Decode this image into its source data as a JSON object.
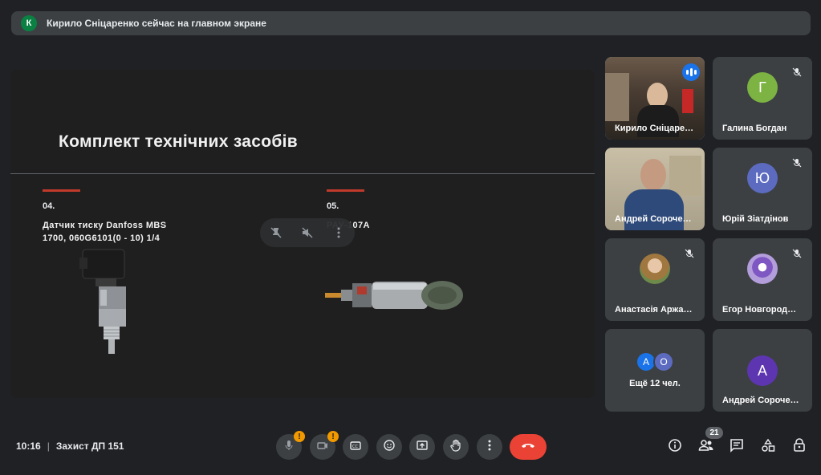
{
  "banner": {
    "avatar_letter": "К",
    "text": "Кирило Сніцаренко сейчас на главном экране"
  },
  "slide": {
    "title": "Комплект технічних засобів",
    "items": [
      {
        "number": "04.",
        "title_line1": "Датчик тиску Danfoss MBS",
        "title_line2": "1700, 060G6101(0 - 10) 1/4"
      },
      {
        "number": "05.",
        "title_line1": "РАУ-107А",
        "title_line2": ""
      }
    ]
  },
  "participants": [
    {
      "name": "Кирило Сніцаре…",
      "type": "video",
      "speaking": true
    },
    {
      "name": "Галина Богдан",
      "letter": "Г",
      "color": "#7cb342",
      "muted": true
    },
    {
      "name": "Андрей Сороче…",
      "type": "video",
      "speaking": false
    },
    {
      "name": "Юрій Зіатдінов",
      "letter": "Ю",
      "color": "#5c6bc0",
      "muted": true
    },
    {
      "name": "Анастасія Аржа…",
      "type": "photo",
      "muted": true
    },
    {
      "name": "Егор Новгород…",
      "type": "photo",
      "muted": true
    },
    {
      "more_text": "Ещё 12 чел.",
      "avatars": [
        "А",
        "О"
      ]
    },
    {
      "name": "Андрей Сороче…",
      "letter": "А",
      "color": "#5e35b1"
    }
  ],
  "bottom_bar": {
    "time": "10:16",
    "separator": "|",
    "meeting_name": "Захист ДП 151",
    "participants_count": "21",
    "mic_warning": "!",
    "cam_warning": "!"
  },
  "icons": [
    "mic-off-icon",
    "camera-off-icon",
    "captions-icon",
    "emoji-icon",
    "present-icon",
    "raise-hand-icon",
    "more-icon",
    "end-call-icon",
    "info-icon",
    "people-icon",
    "chat-icon",
    "activities-icon",
    "host-controls-icon"
  ]
}
